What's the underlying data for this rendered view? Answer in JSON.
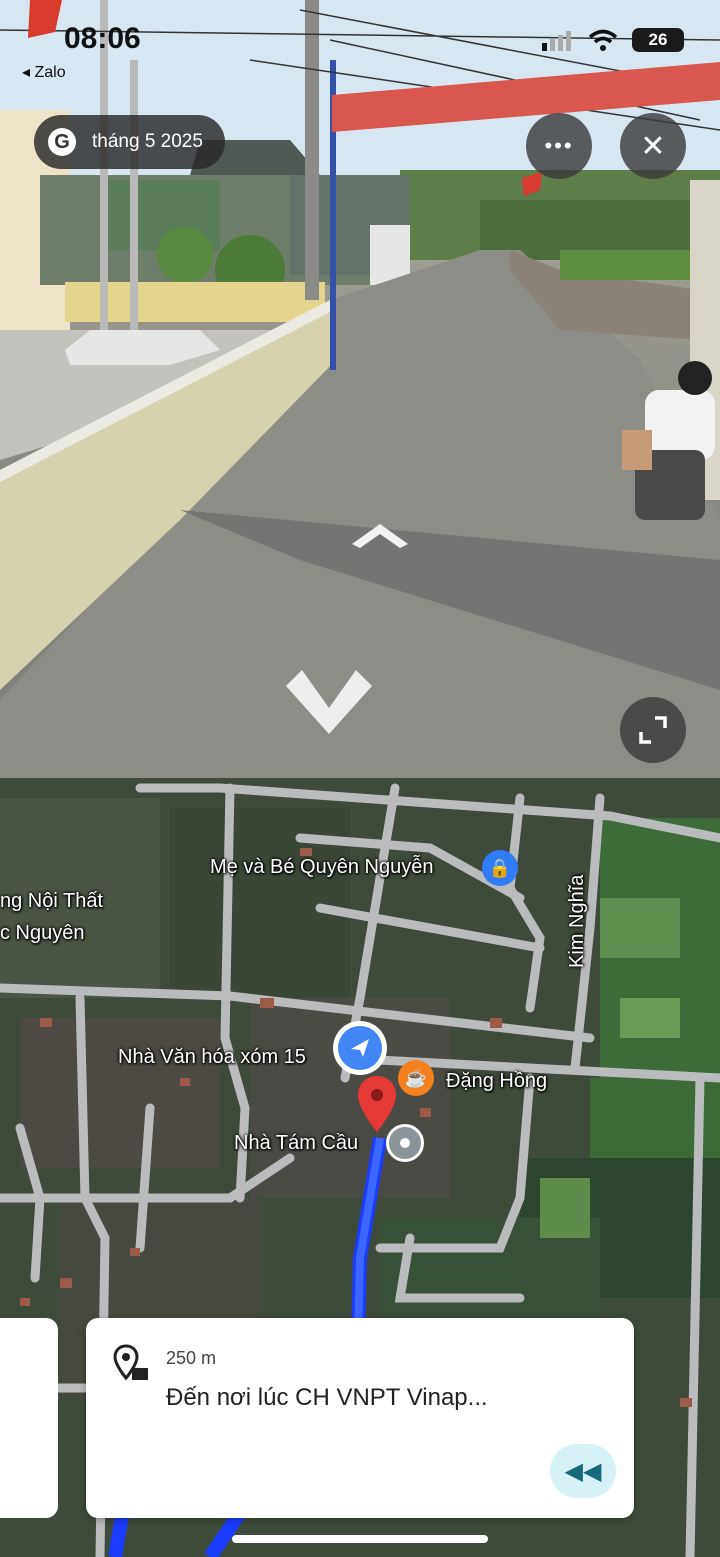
{
  "status_bar": {
    "time": "08:06",
    "back_app": "Zalo",
    "battery": "26",
    "signal_icon": "cell-signal-icon",
    "wifi_icon": "wifi-icon"
  },
  "street_view": {
    "date_label": "tháng 5 2025",
    "more_icon": "more-horizontal-icon",
    "close_icon": "close-icon",
    "expand_icon": "expand-icon",
    "forward_arrow_icon": "chevron-up-icon",
    "back_arrow_icon": "chevron-down-icon"
  },
  "map": {
    "labels": {
      "poi_me_va_be": "Mẹ và Bé Quyên Nguyễn",
      "poi_noi_that_1": "ng Nội Thất",
      "poi_noi_that_2": "c Nguyên",
      "road_kim_nghia": "Kim Nghĩa",
      "poi_nha_van_hoa": "Nhà Văn hóa xóm 15",
      "poi_dang_hong": "Đặng Hồng",
      "poi_nha_tam_cau": "Nhà Tám Cầu"
    },
    "colors": {
      "route": "#1a4dff",
      "pin": "#e53935",
      "location_dot": "#4285f4"
    }
  },
  "nav_card": {
    "distance": "250 m",
    "destination": "Đến nơi lúc CH VNPT Vinap...",
    "rewind_icon": "rewind-icon"
  }
}
